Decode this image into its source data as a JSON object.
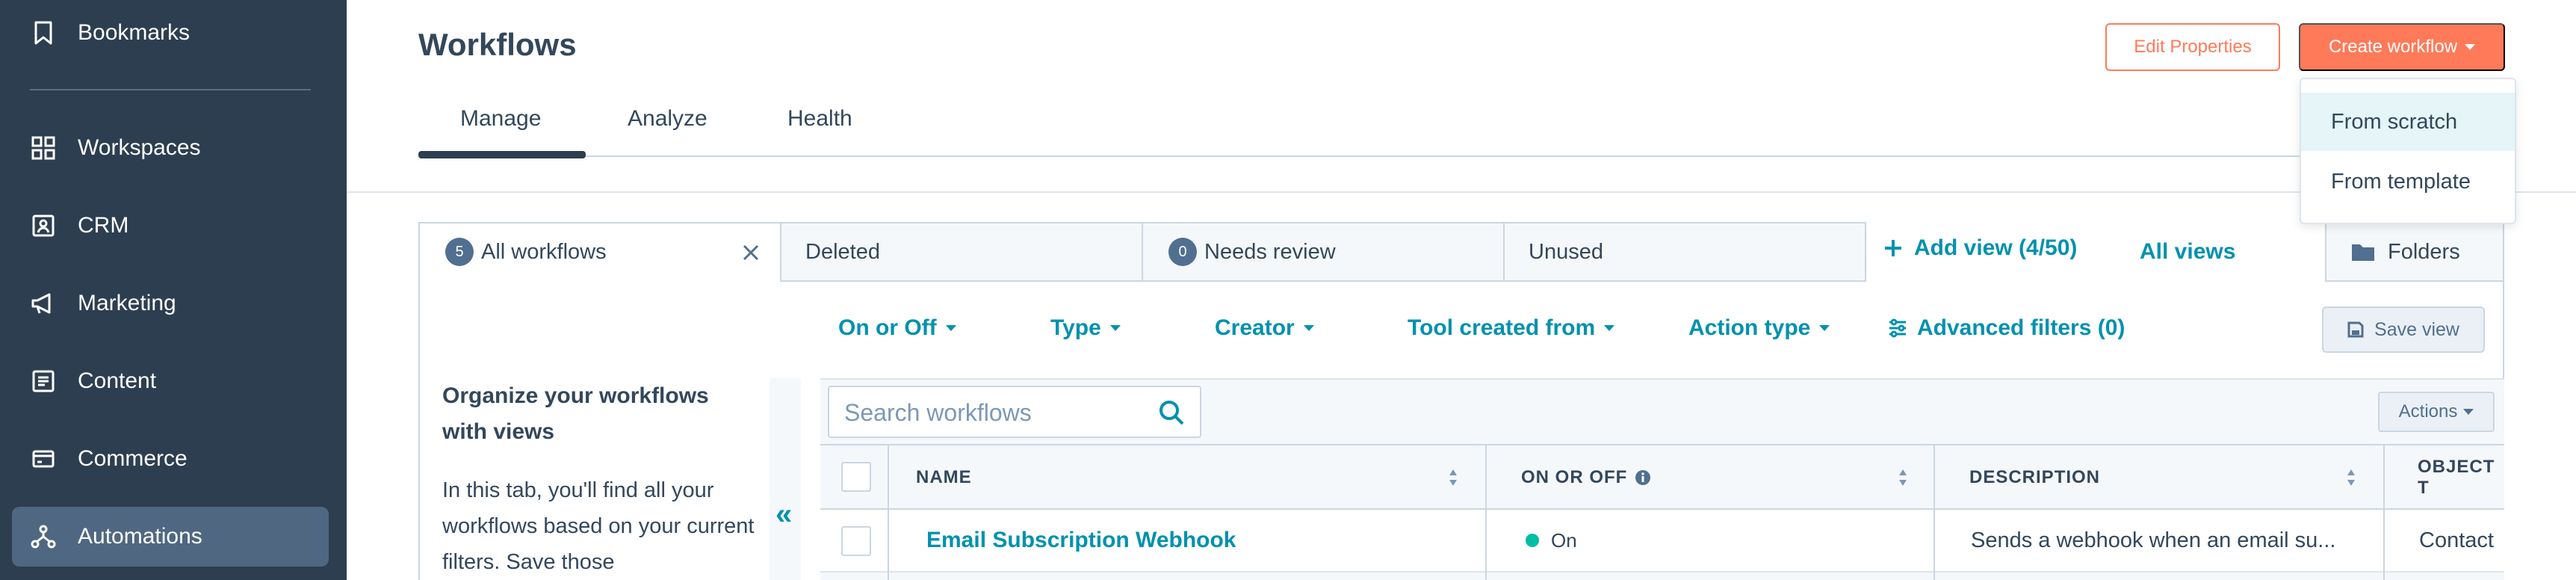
{
  "sidebar": {
    "items": [
      {
        "label": "Bookmarks",
        "icon": "bookmark-icon"
      },
      {
        "label": "Workspaces",
        "icon": "grid-icon"
      },
      {
        "label": "CRM",
        "icon": "contacts-icon"
      },
      {
        "label": "Marketing",
        "icon": "megaphone-icon"
      },
      {
        "label": "Content",
        "icon": "document-icon"
      },
      {
        "label": "Commerce",
        "icon": "cart-icon"
      },
      {
        "label": "Automations",
        "icon": "automation-icon",
        "active": true
      }
    ]
  },
  "header": {
    "title": "Workflows",
    "edit_properties_label": "Edit Properties",
    "create_workflow_label": "Create workflow",
    "tabs": [
      {
        "label": "Manage",
        "active": true
      },
      {
        "label": "Analyze"
      },
      {
        "label": "Health"
      }
    ]
  },
  "create_menu": {
    "items": [
      {
        "label": "From scratch"
      },
      {
        "label": "From template"
      }
    ]
  },
  "views": {
    "tabs": [
      {
        "label": "All workflows",
        "count": "5",
        "active": true
      },
      {
        "label": "Deleted"
      },
      {
        "label": "Needs review",
        "count": "0"
      },
      {
        "label": "Unused"
      }
    ],
    "add_view_label": "Add view (4/50)",
    "all_views_label": "All views",
    "folders_label": "Folders"
  },
  "filters": {
    "items": [
      {
        "label": "On or Off"
      },
      {
        "label": "Type"
      },
      {
        "label": "Creator"
      },
      {
        "label": "Tool created from"
      },
      {
        "label": "Action type"
      }
    ],
    "advanced_label": "Advanced filters (0)",
    "save_view_label": "Save view"
  },
  "info_panel": {
    "title": "Organize your workflows with views",
    "body": "In this tab, you'll find all your workflows based on your current filters. Save those",
    "collapse_glyph": "«"
  },
  "search": {
    "placeholder": "Search workflows"
  },
  "table": {
    "actions_label": "Actions",
    "columns": [
      {
        "label": "NAME"
      },
      {
        "label": "ON OR OFF"
      },
      {
        "label": "DESCRIPTION"
      },
      {
        "label": "OBJECT T"
      }
    ],
    "rows": [
      {
        "name": "Email Subscription Webhook",
        "status": "On",
        "description": "Sends a webhook when an email su...",
        "object_type": "Contact"
      }
    ]
  },
  "colors": {
    "sidebar_bg": "#2d3e50",
    "accent_orange": "#ff7a59",
    "link_teal": "#0091ae",
    "status_on": "#00bda5"
  }
}
